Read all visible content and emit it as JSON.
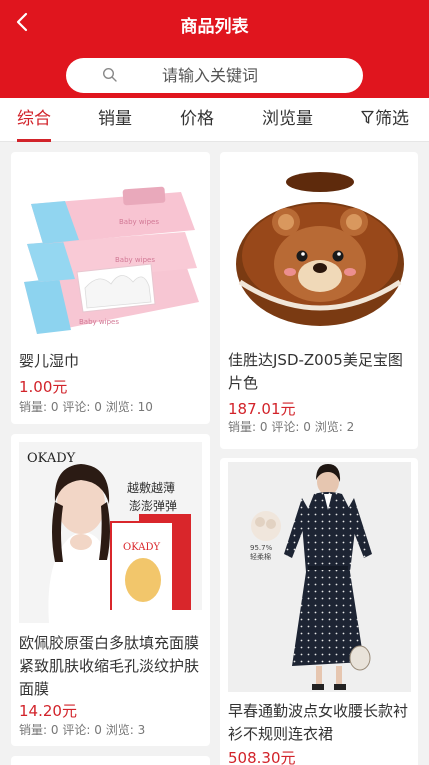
{
  "header": {
    "title": "商品列表",
    "search_placeholder": "请输入关键词"
  },
  "filters": [
    {
      "label": "综合",
      "active": true
    },
    {
      "label": "销量",
      "active": false
    },
    {
      "label": "价格",
      "active": false
    },
    {
      "label": "浏览量",
      "active": false
    },
    {
      "label": "筛选",
      "active": false
    }
  ],
  "meta_labels": {
    "sales": "销量:",
    "comments": "评论:",
    "views": "浏览:"
  },
  "products": [
    {
      "name": "婴儿湿巾",
      "price": "1.00元",
      "sales": "0",
      "comments": "0",
      "views": "10",
      "image": "baby-wipes",
      "package_text": "Baby wipes"
    },
    {
      "name": "佳胜达JSD-Z005美足宝图片色",
      "price": "187.01元",
      "sales": "0",
      "comments": "0",
      "views": "2",
      "image": "bear-foot-warmer"
    },
    {
      "name": "欧佩胶原蛋白多肽填充面膜紧致肌肤收缩毛孔淡纹护肤面膜",
      "price": "14.20元",
      "sales": "0",
      "comments": "0",
      "views": "3",
      "image": "okady-face-mask",
      "brand": "OKADY",
      "slogan_1": "越敷越薄",
      "slogan_2": "澎澎弹弹"
    },
    {
      "name": "早春通勤波点女收腰长款衬衫不规则连衣裙",
      "price": "508.30元",
      "image": "polka-dot-dress",
      "badge_pct": "95.7%",
      "badge_text": "轻柔棉"
    }
  ]
}
